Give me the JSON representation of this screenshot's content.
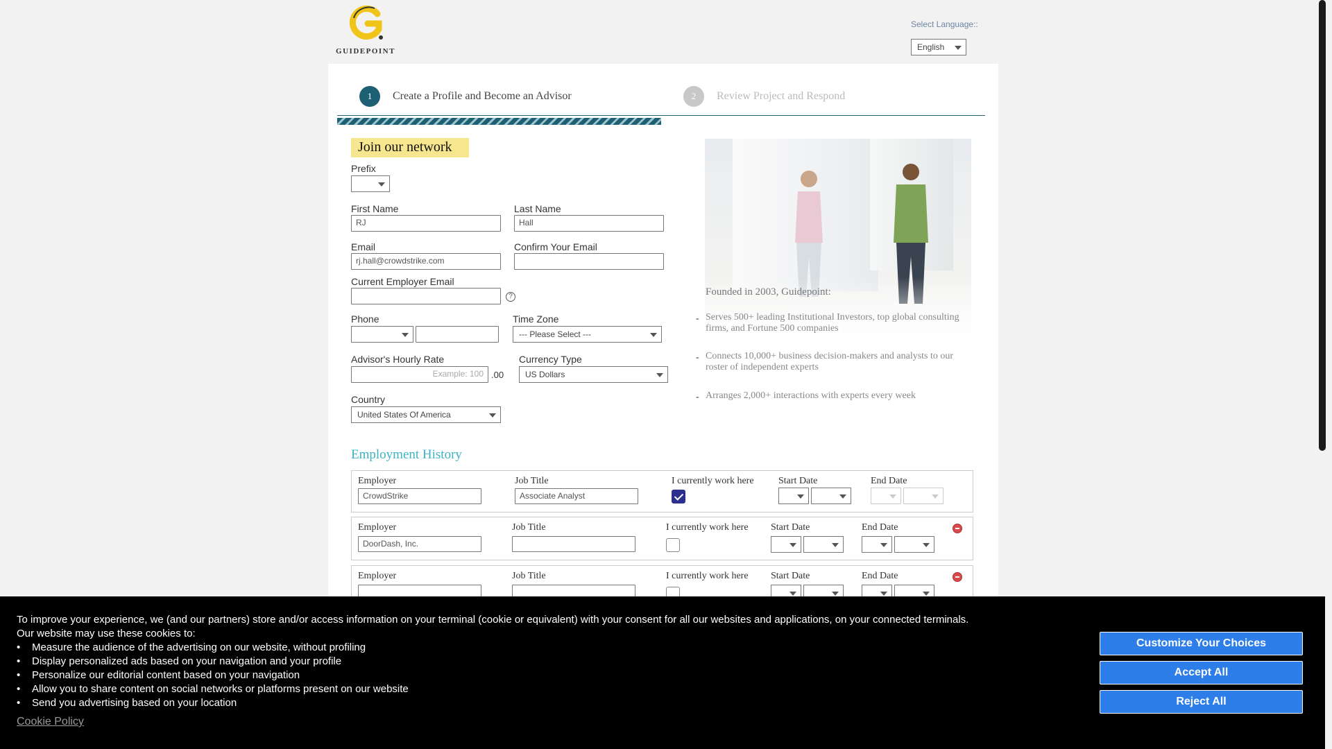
{
  "header": {
    "logo_text": "GUIDEPOINT",
    "language_label": "Select Language::",
    "language_value": "English"
  },
  "steps": [
    {
      "number": "1",
      "label": "Create a Profile and Become an Advisor",
      "active": true
    },
    {
      "number": "2",
      "label": "Review Project and Respond",
      "active": false
    }
  ],
  "progress_fraction": 0.5,
  "form": {
    "title": "Join our network",
    "prefix_label": "Prefix",
    "prefix_value": "",
    "first_name_label": "First Name",
    "first_name_value": "RJ",
    "last_name_label": "Last Name",
    "last_name_value": "Hall",
    "email_label": "Email",
    "email_value": "rj.hall@crowdstrike.com",
    "confirm_email_label": "Confirm Your Email",
    "confirm_email_value": "",
    "employer_email_label": "Current Employer Email",
    "employer_email_value": "",
    "help_icon": "?",
    "phone_label": "Phone",
    "timezone_label": "Time Zone",
    "timezone_value": "--- Please Select ---",
    "rate_label": "Advisor's Hourly Rate",
    "rate_placeholder": "Example: 100",
    "rate_suffix": ".00",
    "currency_label": "Currency Type",
    "currency_value": "US Dollars",
    "country_label": "Country",
    "country_value": "United States Of America"
  },
  "about": {
    "founded": "Founded in 2003, Guidepoint:",
    "bullets": [
      "Serves 500+ leading Institutional Investors, top global consulting firms, and Fortune 500 companies",
      "Connects 10,000+ business decision-makers and analysts to our roster of independent experts",
      "Arranges 2,000+ interactions with experts every week"
    ]
  },
  "employment": {
    "title": "Employment History",
    "labels": {
      "employer": "Employer",
      "job_title": "Job Title",
      "current": "I currently work here",
      "start": "Start Date",
      "end": "End Date"
    },
    "rows": [
      {
        "employer": "CrowdStrike",
        "job_title": "Associate Analyst",
        "current": true
      },
      {
        "employer": "DoorDash, Inc.",
        "job_title": "",
        "current": false
      },
      {
        "employer": "",
        "job_title": "",
        "current": false
      }
    ]
  },
  "cookie": {
    "intro_line1": "To improve your experience, we (and our partners) store and/or access information on your terminal (cookie or equivalent) with your consent for all our websites and applications, on your connected terminals.",
    "intro_line2": "Our website may use these cookies to:",
    "items": [
      "Measure the audience of the advertising on our website, without profiling",
      "Display personalized ads based on your navigation and your profile",
      "Personalize our editorial content based on your navigation",
      "Allow you to share content on social networks or platforms present on our website",
      "Send you advertising based on your location"
    ],
    "policy_link": "Cookie Policy",
    "btn_customize": "Customize Your Choices",
    "btn_accept": "Accept All",
    "btn_reject": "Reject All"
  },
  "colors": {
    "accent_teal": "#1d5f73",
    "heading_teal": "#3ab3c4",
    "highlight_yellow": "#f6e68e",
    "cookie_button": "#2d7ee8"
  }
}
